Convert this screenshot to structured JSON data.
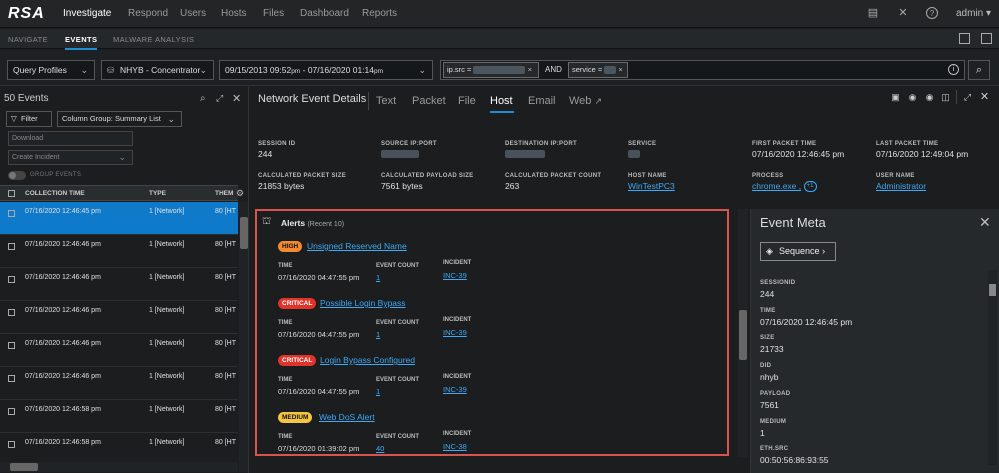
{
  "topnav": {
    "logo": "RSA",
    "items": [
      "Investigate",
      "Respond",
      "Users",
      "Hosts",
      "Files",
      "Dashboard",
      "Reports"
    ],
    "user": "admin",
    "user_caret": "▾"
  },
  "subnav": {
    "items": [
      "NAVIGATE",
      "EVENTS",
      "MALWARE ANALYSIS"
    ]
  },
  "querybar": {
    "query_profiles": "Query Profiles",
    "service": "NHYB - Concentrator",
    "time_range_start": "09/15/2013 09:52",
    "time_range_start_ampm": "pm",
    "time_range_sep": "-",
    "time_range_end": "07/16/2020 01:14",
    "time_range_end_ampm": "pm",
    "pill1_key": "ip.src =",
    "and_label": "AND",
    "pill2_key": "service ="
  },
  "leftpanel": {
    "title": "50 Events",
    "filter_label": "Filter",
    "column_group": "Column Group: Summary List",
    "download_label": "Download",
    "create_incident_label": "Create Incident",
    "group_events_label": "GROUP EVENTS",
    "columns": [
      "COLLECTION TIME",
      "TYPE",
      "THEM"
    ],
    "rows": [
      {
        "time": "07/16/2020 12:46:45 pm",
        "type": "1 [Network]",
        "theme": "80 [HT"
      },
      {
        "time": "07/16/2020 12:46:46 pm",
        "type": "1 [Network]",
        "theme": "80 [HT"
      },
      {
        "time": "07/16/2020 12:46:46 pm",
        "type": "1 [Network]",
        "theme": "80 [HT"
      },
      {
        "time": "07/16/2020 12:46:46 pm",
        "type": "1 [Network]",
        "theme": "80 [HT"
      },
      {
        "time": "07/16/2020 12:46:46 pm",
        "type": "1 [Network]",
        "theme": "80 [HT"
      },
      {
        "time": "07/16/2020 12:46:46 pm",
        "type": "1 [Network]",
        "theme": "80 [HT"
      },
      {
        "time": "07/16/2020 12:46:58 pm",
        "type": "1 [Network]",
        "theme": "80 [HT"
      },
      {
        "time": "07/16/2020 12:46:58 pm",
        "type": "1 [Network]",
        "theme": "80 [HT"
      }
    ]
  },
  "detail": {
    "title": "Network Event Details",
    "tabs": [
      "Text",
      "Packet",
      "File",
      "Host",
      "Email",
      "Web"
    ],
    "meta": {
      "session_id_label": "SESSION ID",
      "session_id": "244",
      "source_label": "SOURCE IP:PORT",
      "dest_label": "DESTINATION IP:PORT",
      "service_label": "SERVICE",
      "first_packet_label": "FIRST PACKET TIME",
      "first_packet": "07/16/2020 12:46:45 pm",
      "last_packet_label": "LAST PACKET TIME",
      "last_packet": "07/16/2020 12:49:04 pm",
      "calc_size_label": "CALCULATED PACKET SIZE",
      "calc_size": "21853 bytes",
      "calc_payload_label": "CALCULATED PAYLOAD SIZE",
      "calc_payload": "7561 bytes",
      "calc_count_label": "CALCULATED PACKET COUNT",
      "calc_count": "263",
      "host_name_label": "HOST NAME",
      "host_name": "WinTestPC3",
      "process_label": "PROCESS",
      "process": "chrome.exe ,",
      "process_more": "+1",
      "user_name_label": "USER NAME",
      "user_name": "Administrator"
    }
  },
  "alerts": {
    "title": "Alerts",
    "subtitle": "(Recent 10)",
    "time_label": "TIME",
    "count_label": "EVENT COUNT",
    "incident_label": "INCIDENT",
    "items": [
      {
        "severity": "HIGH",
        "name": "Unsigned Reserved Name",
        "time": "07/16/2020 04:47:55 pm",
        "count": "1",
        "incident": "INC-39"
      },
      {
        "severity": "CRITICAL",
        "name": "Possible Login Bypass",
        "time": "07/16/2020 04:47:55 pm",
        "count": "1",
        "incident": "INC-39"
      },
      {
        "severity": "CRITICAL",
        "name": "Login Bypass Configured",
        "time": "07/16/2020 04:47:55 pm",
        "count": "1",
        "incident": "INC-39"
      },
      {
        "severity": "MEDIUM",
        "name": "Web DoS Alert",
        "time": "07/16/2020 01:39:02 pm",
        "count": "40",
        "incident": "INC-38"
      }
    ]
  },
  "event_meta": {
    "title": "Event Meta",
    "sequence_label": "Sequence",
    "fields": [
      {
        "label": "SESSIONID",
        "value": "244"
      },
      {
        "label": "TIME",
        "value": "07/16/2020 12:46:45 pm"
      },
      {
        "label": "SIZE",
        "value": "21733"
      },
      {
        "label": "DID",
        "value": "nhyb"
      },
      {
        "label": "PAYLOAD",
        "value": "7561"
      },
      {
        "label": "MEDIUM",
        "value": "1"
      },
      {
        "label": "ETH.SRC",
        "value": "00:50:56:86:93:55"
      }
    ]
  },
  "colors": {
    "accent": "#1b8fd2",
    "selected_row": "#0f7ac9",
    "link": "#3fa9f5",
    "alert_border": "#d9534f",
    "sev_high": "#f28b30",
    "sev_critical": "#e0342b",
    "sev_medium": "#f4c542"
  },
  "icons": [
    "notes-icon",
    "tools-icon",
    "help-icon",
    "search-icon",
    "expand-icon",
    "close-icon",
    "settings-icon",
    "filter-icon",
    "external-link-icon",
    "sequence-icon",
    "alert-icon"
  ]
}
